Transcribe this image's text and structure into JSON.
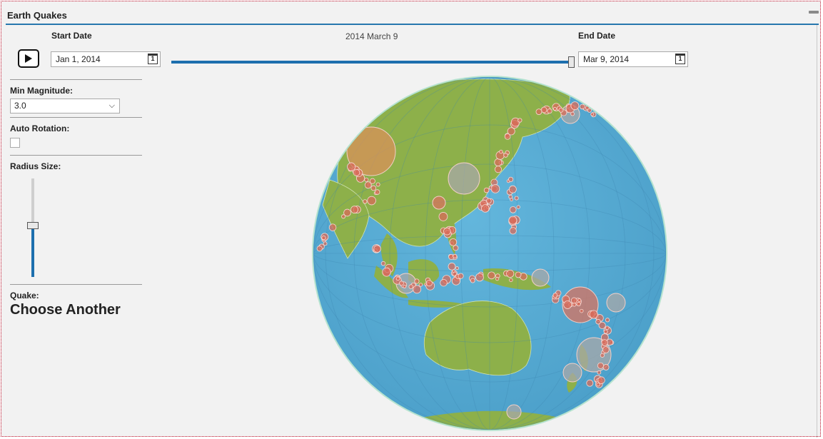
{
  "app": {
    "title": "Earth Quakes"
  },
  "controls": {
    "start_label": "Start Date",
    "start_value": "Jan 1, 2014",
    "end_label": "End Date",
    "end_value": "Mar 9, 2014",
    "current_date": "2014 March 9",
    "calendar_glyph": "1",
    "timeline_fraction": 1.0,
    "play_icon": "play-icon"
  },
  "sidebar": {
    "min_magnitude_label": "Min Magnitude:",
    "min_magnitude_value": "3.0",
    "auto_rotation_label": "Auto Rotation:",
    "auto_rotation_checked": false,
    "radius_label": "Radius Size:",
    "radius_fraction": 0.5,
    "quake_label": "Quake:",
    "quake_value": "Choose Another"
  },
  "colors": {
    "ocean": "#5aaed3",
    "land": "#8db04a",
    "accent": "#1d6fae",
    "quake_fill": "#d86b5a"
  }
}
